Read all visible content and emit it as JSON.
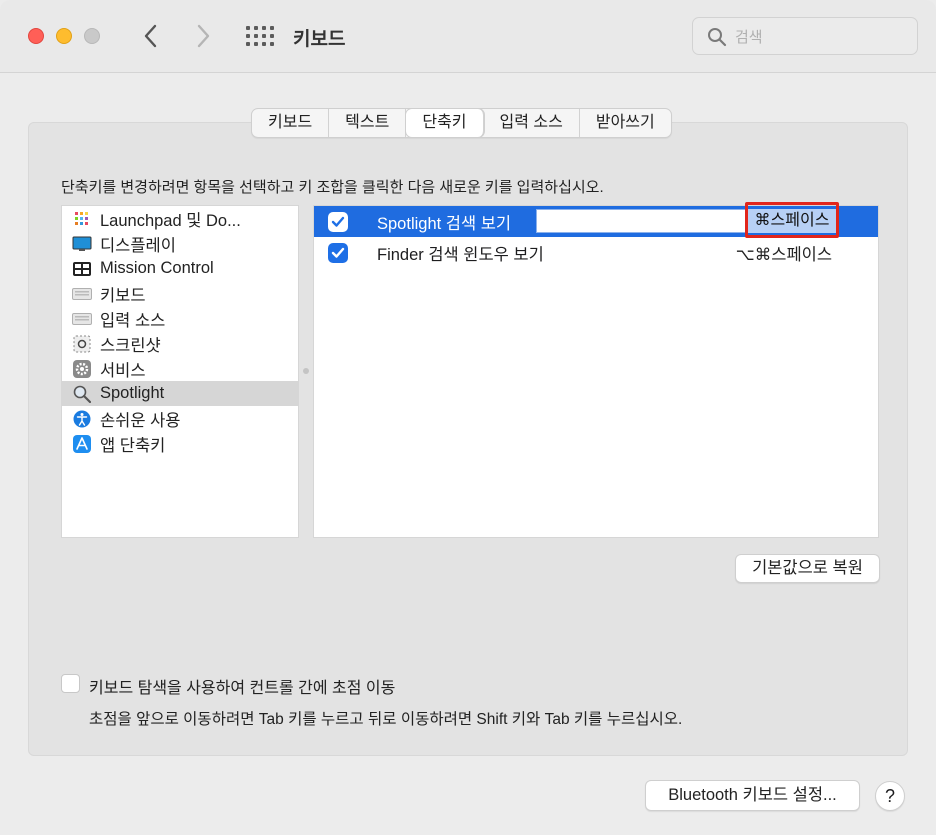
{
  "window": {
    "title": "키보드",
    "search_placeholder": "검색",
    "icons": [
      "chevron-left-icon",
      "chevron-right-icon",
      "grid-icon",
      "search-icon"
    ]
  },
  "tabs": [
    {
      "label": "키보드",
      "active": false
    },
    {
      "label": "텍스트",
      "active": false
    },
    {
      "label": "단축키",
      "active": true
    },
    {
      "label": "입력 소스",
      "active": false
    },
    {
      "label": "받아쓰기",
      "active": false
    }
  ],
  "instruction": "단축키를 변경하려면 항목을 선택하고 키 조합을 클릭한 다음 새로운 키를 입력하십시오.",
  "categories": [
    {
      "label": "Launchpad 및 Do...",
      "icon": "launchpad-icon",
      "selected": false
    },
    {
      "label": "디스플레이",
      "icon": "display-icon",
      "selected": false
    },
    {
      "label": "Mission Control",
      "icon": "mission-control-icon",
      "selected": false
    },
    {
      "label": "키보드",
      "icon": "keyboard-icon",
      "selected": false
    },
    {
      "label": "입력 소스",
      "icon": "input-sources-icon",
      "selected": false
    },
    {
      "label": "스크린샷",
      "icon": "screenshot-icon",
      "selected": false
    },
    {
      "label": "서비스",
      "icon": "services-gear-icon",
      "selected": false
    },
    {
      "label": "Spotlight",
      "icon": "spotlight-icon",
      "selected": true
    },
    {
      "label": "손쉬운 사용",
      "icon": "accessibility-icon",
      "selected": false
    },
    {
      "label": "앱 단축키",
      "icon": "app-store-icon",
      "selected": false
    }
  ],
  "shortcuts": [
    {
      "label": "Spotlight 검색 보기",
      "checked": true,
      "key": "⌘스페이스",
      "selected": true,
      "editing": true
    },
    {
      "label": "Finder 검색 윈도우 보기",
      "checked": true,
      "key": "⌥⌘스페이스",
      "selected": false,
      "editing": false
    }
  ],
  "buttons": {
    "reset": "기본값으로 복원",
    "bluetooth": "Bluetooth 키보드 설정...",
    "help": "?"
  },
  "keyboard_nav": {
    "checked": false,
    "label": "키보드 탐색을 사용하여 컨트롤 간에 초점 이동",
    "hint": "초점을 앞으로 이동하려면 Tab 키를 누르고 뒤로 이동하려면 Shift 키와 Tab 키를 누르십시오."
  },
  "colors": {
    "selection_blue": "#1f6ce0",
    "checkbox_blue": "#1e6fe6",
    "highlight_red": "#e1251b",
    "key_selection": "#b7d0f5"
  }
}
